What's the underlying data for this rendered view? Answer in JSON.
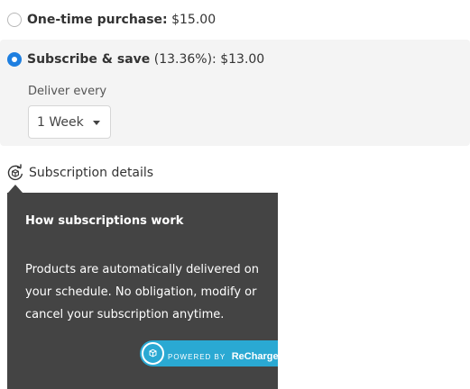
{
  "options": {
    "one_time": {
      "label": "One-time purchase:",
      "price": "$15.00",
      "selected": false
    },
    "subscribe": {
      "label": "Subscribe & save",
      "discount": "(13.36%):",
      "price": "$13.00",
      "selected": true
    }
  },
  "delivery": {
    "label": "Deliver every",
    "selected": "1 Week"
  },
  "details_link": {
    "label": "Subscription details",
    "icon": "subscription-cycle-icon"
  },
  "tooltip": {
    "title": "How subscriptions work",
    "body": "Products are automatically delivered on your schedule. No obligation, modify or cancel your subscription anytime.",
    "badge": {
      "powered_by": "POWERED BY",
      "brand": "ReCharge"
    }
  },
  "colors": {
    "radio_selected": "#1e7fe0",
    "tooltip_bg": "#444444",
    "badge_bg": "#2aa9d3",
    "option_box_bg": "#f4f4f4"
  }
}
